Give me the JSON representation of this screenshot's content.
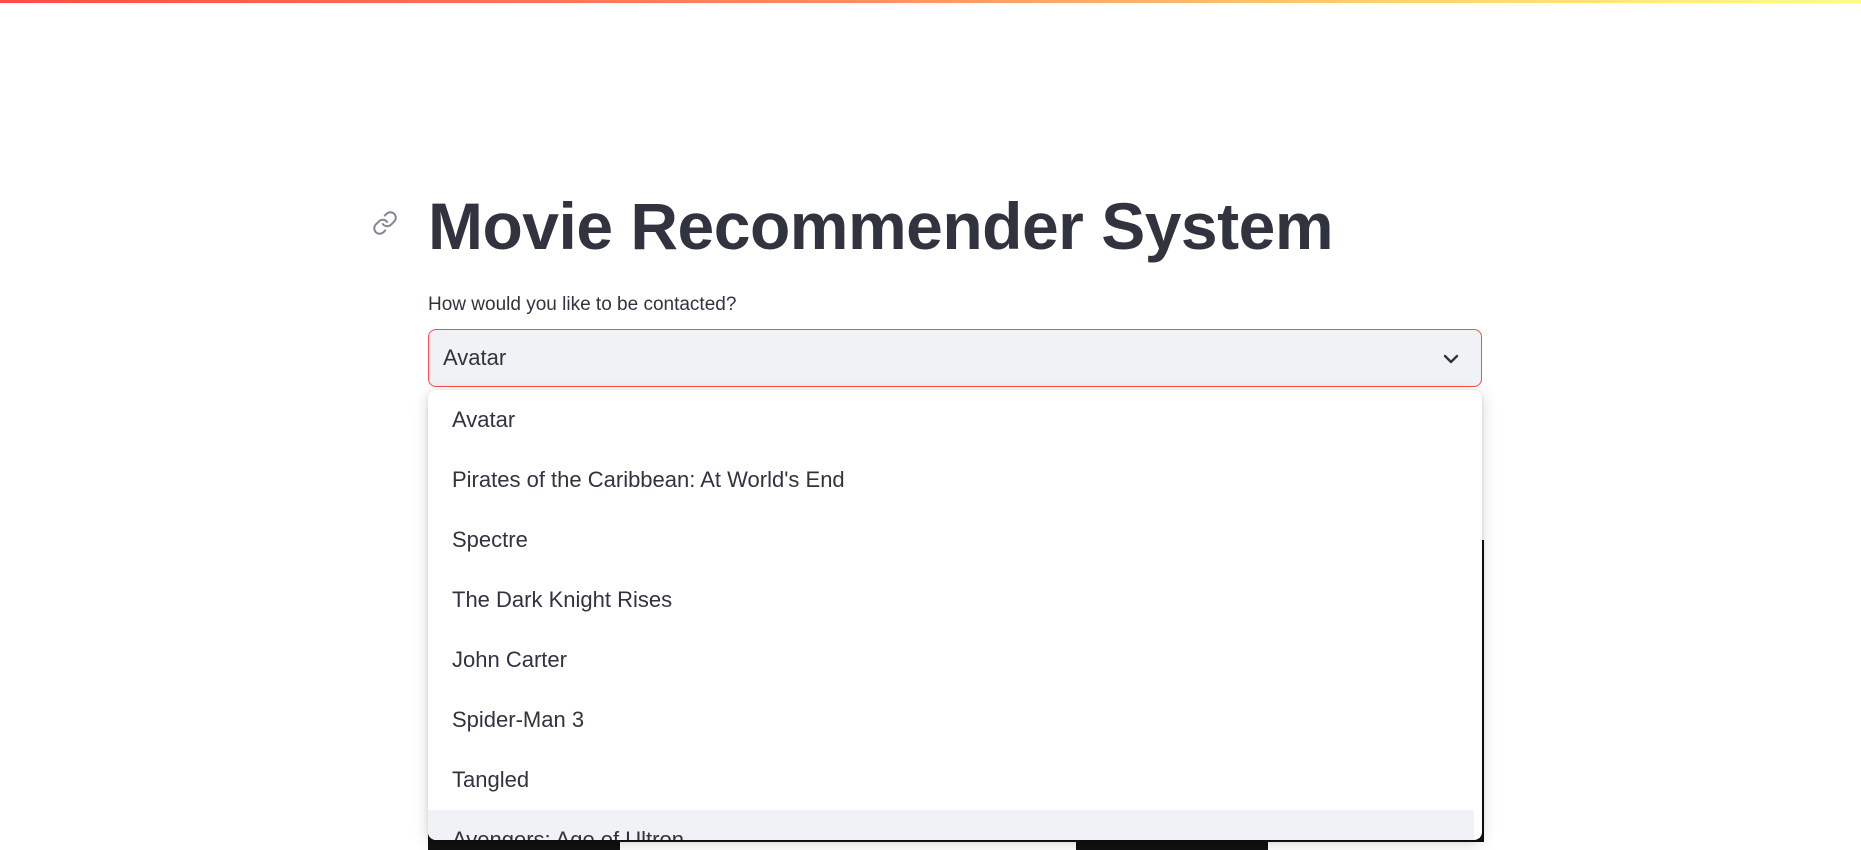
{
  "page": {
    "title": "Movie Recommender System"
  },
  "select": {
    "label": "How would you like to be contacted?",
    "value": "Avatar",
    "options": [
      "Avatar",
      "Pirates of the Caribbean: At World's End",
      "Spectre",
      "The Dark Knight Rises",
      "John Carter",
      "Spider-Man 3",
      "Tangled",
      "Avengers: Age of Ultron"
    ]
  },
  "icons": {
    "anchor": "link-icon",
    "chevron": "chevron-down-icon"
  },
  "colors": {
    "accent": "#ff4b4b",
    "text": "#31333f",
    "input_bg": "#f0f2f6"
  }
}
